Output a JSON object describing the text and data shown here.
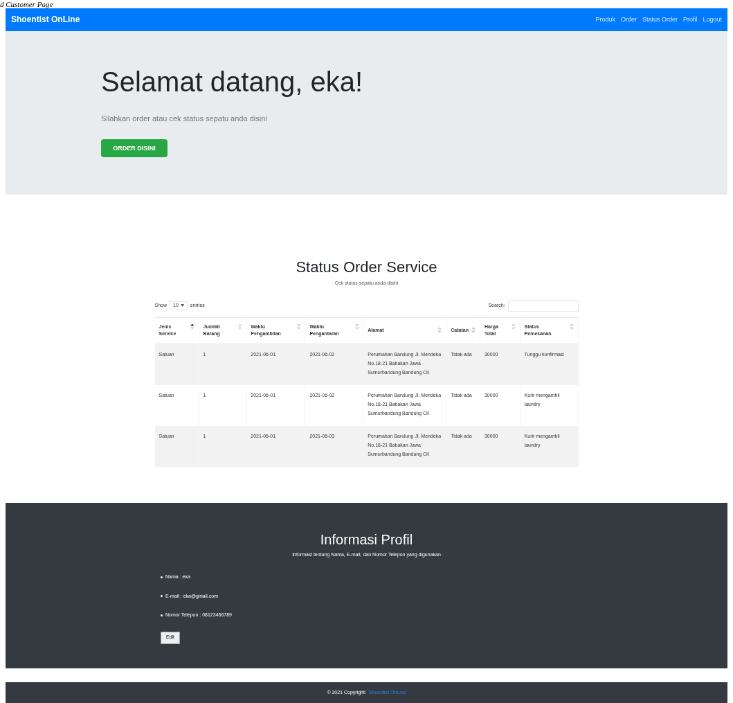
{
  "caption": "d Customer Page",
  "navbar": {
    "brand": "Shoentist OnLine",
    "links": [
      "Produk",
      "Order",
      "Status Order",
      "Profil",
      "Logout"
    ]
  },
  "hero": {
    "title": "Selamat datang, eka!",
    "text": "Silahkan order atau cek status sepatu anda disini",
    "button": "ORDER DISINI"
  },
  "status": {
    "title": "Status Order Service",
    "subtitle": "Cek status sepatu anda disini",
    "show_label": "Show",
    "entries_value": "10",
    "entries_label": "entries",
    "search_label": "Search:",
    "columns": [
      {
        "label": "Jenis Service",
        "sorted": true
      },
      {
        "label": "Jumlah Barang",
        "sorted": false
      },
      {
        "label": "Waktu Pengambilan",
        "sorted": false
      },
      {
        "label": "Waktu Pengantaran",
        "sorted": false
      },
      {
        "label": "Alamat",
        "sorted": false
      },
      {
        "label": "Catatan",
        "sorted": false
      },
      {
        "label": "Harga Total",
        "sorted": false
      },
      {
        "label": "Status Pemesanan",
        "sorted": false
      }
    ],
    "rows": [
      [
        "Satuan",
        "1",
        "2021-06-01",
        "2021-06-02",
        "Perumahan Bandung Jl. Mendeka No.18-21 Babakan Jawa Sumurbandung Bandung CK",
        "Tidak ada",
        "30000",
        "Tunggu konfirmasi"
      ],
      [
        "Satuan",
        "1",
        "2021-06-01",
        "2021-06-02",
        "Perumahan Bandung Jl. Mendeka No.18-21 Babakan Jawa Sumurbandung Bandung CK",
        "Tidak ada",
        "30000",
        "Kurir mengambil laundry"
      ],
      [
        "Satuan",
        "1",
        "2021-06-01",
        "2021-06-03",
        "Perumahan Bandung Jl. Mendeka No.18-21 Babakan Jawa Sumurbandung Bandung CK",
        "Tidak ada",
        "30000",
        "Kurir mengambil laundry"
      ]
    ]
  },
  "profile": {
    "title": "Informasi Profil",
    "subtitle": "Informasi tentang Nama, E-mail, dan Nomor Telepon yang digunakan",
    "items": [
      "Nama : eka",
      "E-mail : eka@gmail.com",
      "Nomor Telepon : 08123456789"
    ],
    "button": "Edit"
  },
  "footer": {
    "text": "© 2021 Copyright:",
    "link": "Shoentist OnLine"
  }
}
